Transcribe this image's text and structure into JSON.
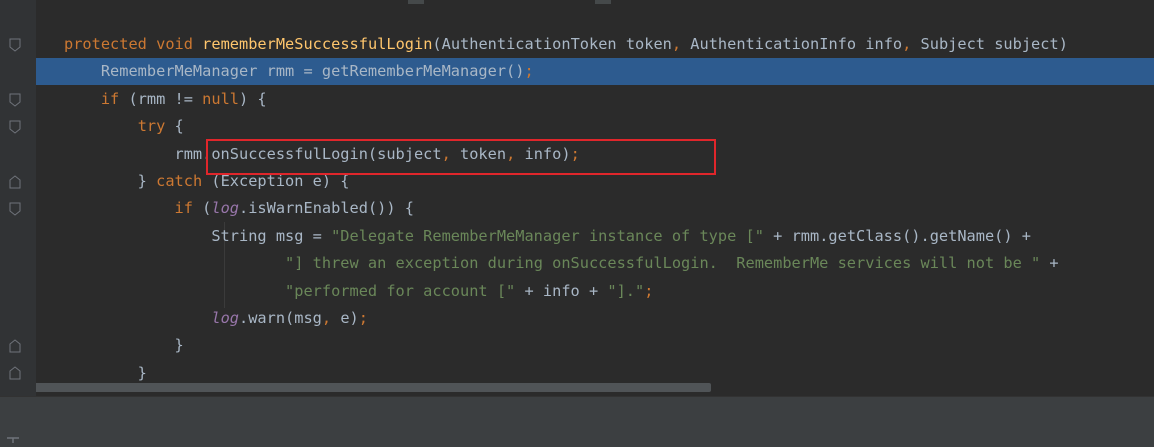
{
  "editor": {
    "language": "java",
    "highlighted_line_index": 1,
    "boxed_line_index": 3,
    "lines": [
      {
        "segments": [
          {
            "t": "protected ",
            "c": "kw"
          },
          {
            "t": "void ",
            "c": "kw"
          },
          {
            "t": "rememberMeSuccessfulLogin",
            "c": "fn"
          },
          {
            "t": "(AuthenticationToken token",
            "c": ""
          },
          {
            "t": ", ",
            "c": "kw"
          },
          {
            "t": "AuthenticationInfo info",
            "c": ""
          },
          {
            "t": ", ",
            "c": "kw"
          },
          {
            "t": "Subject subject)",
            "c": ""
          }
        ]
      },
      {
        "segments": [
          {
            "t": "    RememberMeManager rmm = getRememberMeManager()",
            "c": ""
          },
          {
            "t": ";",
            "c": "kw"
          }
        ]
      },
      {
        "segments": [
          {
            "t": "    ",
            "c": ""
          },
          {
            "t": "if ",
            "c": "kw"
          },
          {
            "t": "(rmm != ",
            "c": ""
          },
          {
            "t": "null",
            "c": "kw"
          },
          {
            "t": ") {",
            "c": ""
          }
        ]
      },
      {
        "segments": [
          {
            "t": "        ",
            "c": ""
          },
          {
            "t": "try ",
            "c": "kw"
          },
          {
            "t": "{",
            "c": ""
          }
        ]
      },
      {
        "segments": [
          {
            "t": "            rmm.onSuccessfulLogin(subject",
            "c": ""
          },
          {
            "t": ", ",
            "c": "kw"
          },
          {
            "t": "token",
            "c": ""
          },
          {
            "t": ", ",
            "c": "kw"
          },
          {
            "t": "info)",
            "c": ""
          },
          {
            "t": ";",
            "c": "kw"
          }
        ]
      },
      {
        "segments": [
          {
            "t": "        } ",
            "c": ""
          },
          {
            "t": "catch ",
            "c": "kw"
          },
          {
            "t": "(Exception e) {",
            "c": ""
          }
        ]
      },
      {
        "segments": [
          {
            "t": "            ",
            "c": ""
          },
          {
            "t": "if ",
            "c": "kw"
          },
          {
            "t": "(",
            "c": ""
          },
          {
            "t": "log",
            "c": "fld"
          },
          {
            "t": ".isWarnEnabled()) {",
            "c": ""
          }
        ]
      },
      {
        "segments": [
          {
            "t": "                String msg = ",
            "c": ""
          },
          {
            "t": "\"Delegate RememberMeManager instance of type [\"",
            "c": "str"
          },
          {
            "t": " + rmm.getClass().getName() +",
            "c": ""
          }
        ]
      },
      {
        "segments": [
          {
            "t": "                        ",
            "c": ""
          },
          {
            "t": "\"] threw an exception during onSuccessfulLogin.  RememberMe services will not be \"",
            "c": "str"
          },
          {
            "t": " +",
            "c": ""
          }
        ]
      },
      {
        "segments": [
          {
            "t": "                        ",
            "c": ""
          },
          {
            "t": "\"performed for account [\"",
            "c": "str"
          },
          {
            "t": " + info + ",
            "c": ""
          },
          {
            "t": "\"].\"",
            "c": "str"
          },
          {
            "t": ";",
            "c": "kw"
          }
        ]
      },
      {
        "segments": [
          {
            "t": "                ",
            "c": ""
          },
          {
            "t": "log",
            "c": "fld"
          },
          {
            "t": ".warn(msg",
            "c": ""
          },
          {
            "t": ", ",
            "c": "kw"
          },
          {
            "t": "e)",
            "c": ""
          },
          {
            "t": ";",
            "c": "kw"
          }
        ]
      },
      {
        "segments": [
          {
            "t": "            }",
            "c": ""
          }
        ]
      },
      {
        "segments": [
          {
            "t": "        }",
            "c": ""
          }
        ]
      }
    ]
  },
  "colors": {
    "background": "#2b2b2b",
    "gutter": "#313335",
    "keyword": "#cc7832",
    "method": "#ffc66d",
    "string": "#6a8759",
    "field": "#9876aa",
    "text": "#a9b7c6",
    "selection": "#2d5b8f",
    "annotation_box": "#e0262b"
  }
}
